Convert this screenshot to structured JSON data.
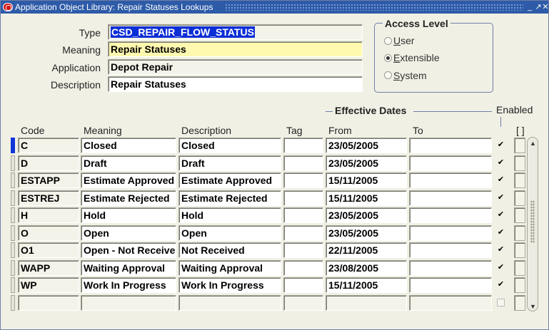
{
  "window": {
    "title": "Application Object Library: Repair Statuses Lookups",
    "btn_minimize": "_",
    "btn_maximize": "↗",
    "btn_close": "✕"
  },
  "header": {
    "type_label": "Type",
    "type_value": "CSD_REPAIR_FLOW_STATUS",
    "meaning_label": "Meaning",
    "meaning_value": "Repair Statuses",
    "application_label": "Application",
    "application_value": "Depot Repair",
    "description_label": "Description",
    "description_value": "Repair Statuses"
  },
  "access_level": {
    "title": "Access Level",
    "options": [
      {
        "label": "User",
        "mnemonic": "U",
        "rest": "ser",
        "selected": false
      },
      {
        "label": "Extensible",
        "mnemonic": "E",
        "rest": "xtensible",
        "selected": true
      },
      {
        "label": "System",
        "mnemonic": "S",
        "rest": "ystem",
        "selected": false
      }
    ]
  },
  "grid": {
    "effective_dates_title": "Effective Dates",
    "enabled_title": "Enabled",
    "columns": {
      "code": "Code",
      "meaning": "Meaning",
      "description": "Description",
      "tag": "Tag",
      "from": "From",
      "to": "To",
      "extra": "[ ]"
    },
    "checkmark": "✔",
    "rows": [
      {
        "code": "C",
        "meaning": "Closed",
        "description": "Closed",
        "tag": "",
        "from": "23/05/2005",
        "to": "",
        "enabled": true
      },
      {
        "code": "D",
        "meaning": "Draft",
        "description": "Draft",
        "tag": "",
        "from": "23/05/2005",
        "to": "",
        "enabled": true
      },
      {
        "code": "ESTAPP",
        "meaning": "Estimate Approved",
        "description": "Estimate Approved",
        "tag": "",
        "from": "15/11/2005",
        "to": "",
        "enabled": true
      },
      {
        "code": "ESTREJ",
        "meaning": "Estimate Rejected",
        "description": "Estimate Rejected",
        "tag": "",
        "from": "15/11/2005",
        "to": "",
        "enabled": true
      },
      {
        "code": "H",
        "meaning": "Hold",
        "description": "Hold",
        "tag": "",
        "from": "23/05/2005",
        "to": "",
        "enabled": true
      },
      {
        "code": "O",
        "meaning": "Open",
        "description": "Open",
        "tag": "",
        "from": "23/05/2005",
        "to": "",
        "enabled": true
      },
      {
        "code": "O1",
        "meaning": "Open - Not Received",
        "description": "Not Received",
        "tag": "",
        "from": "22/11/2005",
        "to": "",
        "enabled": true
      },
      {
        "code": "WAPP",
        "meaning": "Waiting Approval",
        "description": "Waiting Approval",
        "tag": "",
        "from": "23/08/2005",
        "to": "",
        "enabled": true
      },
      {
        "code": "WP",
        "meaning": "Work In Progress",
        "description": "Work In Progress",
        "tag": "",
        "from": "15/11/2005",
        "to": "",
        "enabled": true
      },
      {
        "code": "",
        "meaning": "",
        "description": "",
        "tag": "",
        "from": "",
        "to": "",
        "enabled": false
      }
    ]
  },
  "colors": {
    "titlebar": "#2d5ba8",
    "selection": "#0b2ed6",
    "highlight_field": "#fff9b0",
    "background": "#f1f0e5"
  }
}
